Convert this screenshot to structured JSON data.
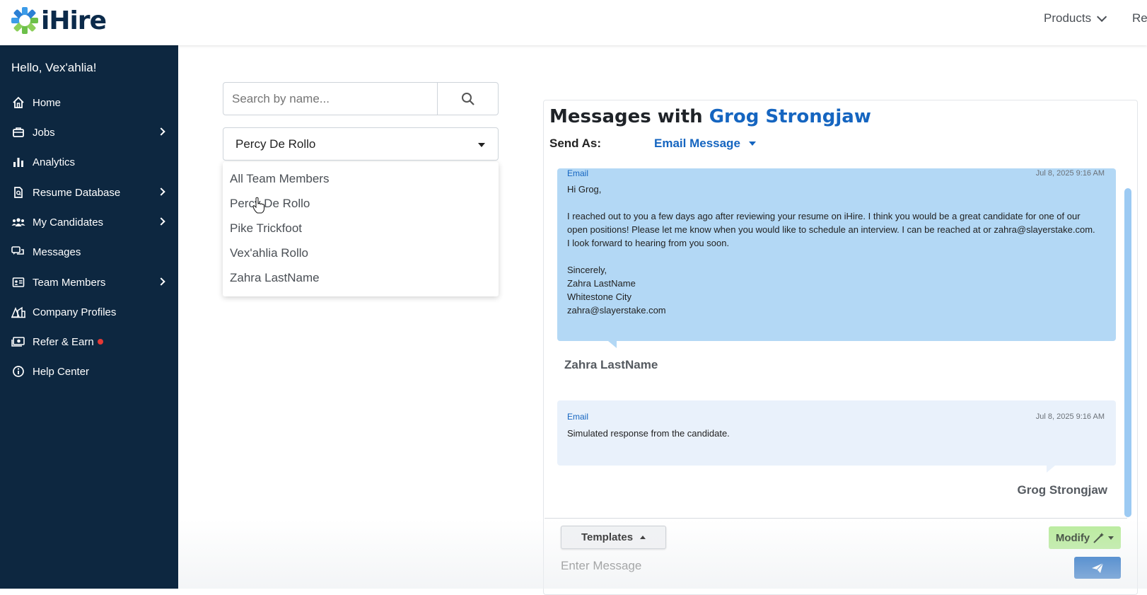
{
  "brand": {
    "name": "iHire",
    "primary": "#0d2740",
    "accent": "#1565c0"
  },
  "topnav": {
    "products_label": "Products",
    "resources_label": "Res"
  },
  "sidebar": {
    "greeting": "Hello, Vex'ahlia!",
    "items": [
      {
        "label": "Home",
        "icon": "home-icon",
        "has_submenu": false
      },
      {
        "label": "Jobs",
        "icon": "briefcase-icon",
        "has_submenu": true
      },
      {
        "label": "Analytics",
        "icon": "bar-chart-icon",
        "has_submenu": false
      },
      {
        "label": "Resume Database",
        "icon": "document-search-icon",
        "has_submenu": true
      },
      {
        "label": "My Candidates",
        "icon": "people-icon",
        "has_submenu": true
      },
      {
        "label": "Messages",
        "icon": "chat-icon",
        "has_submenu": false
      },
      {
        "label": "Team Members",
        "icon": "id-card-icon",
        "has_submenu": true
      },
      {
        "label": "Company Profiles",
        "icon": "buildings-icon",
        "has_submenu": false
      },
      {
        "label": "Refer & Earn",
        "icon": "cash-icon",
        "has_submenu": false,
        "badge": "red-dot"
      },
      {
        "label": "Help Center",
        "icon": "info-icon",
        "has_submenu": false
      }
    ]
  },
  "search": {
    "placeholder": "Search by name..."
  },
  "team_filter": {
    "selected": "Percy De Rollo",
    "options": [
      "All Team Members",
      "Percy De Rollo",
      "Pike Trickfoot",
      "Vex'ahlia Rollo",
      "Zahra LastName"
    ]
  },
  "conversation": {
    "title_prefix": "Messages with",
    "candidate_name": "Grog Strongjaw",
    "send_as_label": "Send As:",
    "send_as_value": "Email Message",
    "messages": [
      {
        "type": "Email",
        "timestamp": "Jul 8, 2025 9:16 AM",
        "lines": [
          "Hi Grog,",
          "",
          "I reached out to you a few days ago after reviewing your resume on iHire. I think you would be a great candidate for one of our",
          "open positions! Please let me know when you would like to schedule an interview. I can be reached at or zahra@slayerstake.com.",
          "I look forward to hearing from you soon.",
          "",
          "Sincerely,",
          "Zahra LastName",
          "Whitestone City",
          "zahra@slayerstake.com"
        ],
        "sender": "Zahra LastName"
      },
      {
        "type": "Email",
        "timestamp": "Jul 8, 2025 9:16 AM",
        "lines": [
          "Simulated response from the candidate."
        ],
        "sender": "Grog Strongjaw"
      }
    ],
    "templates_label": "Templates",
    "modify_label": "Modify",
    "input_placeholder": "Enter Message"
  }
}
